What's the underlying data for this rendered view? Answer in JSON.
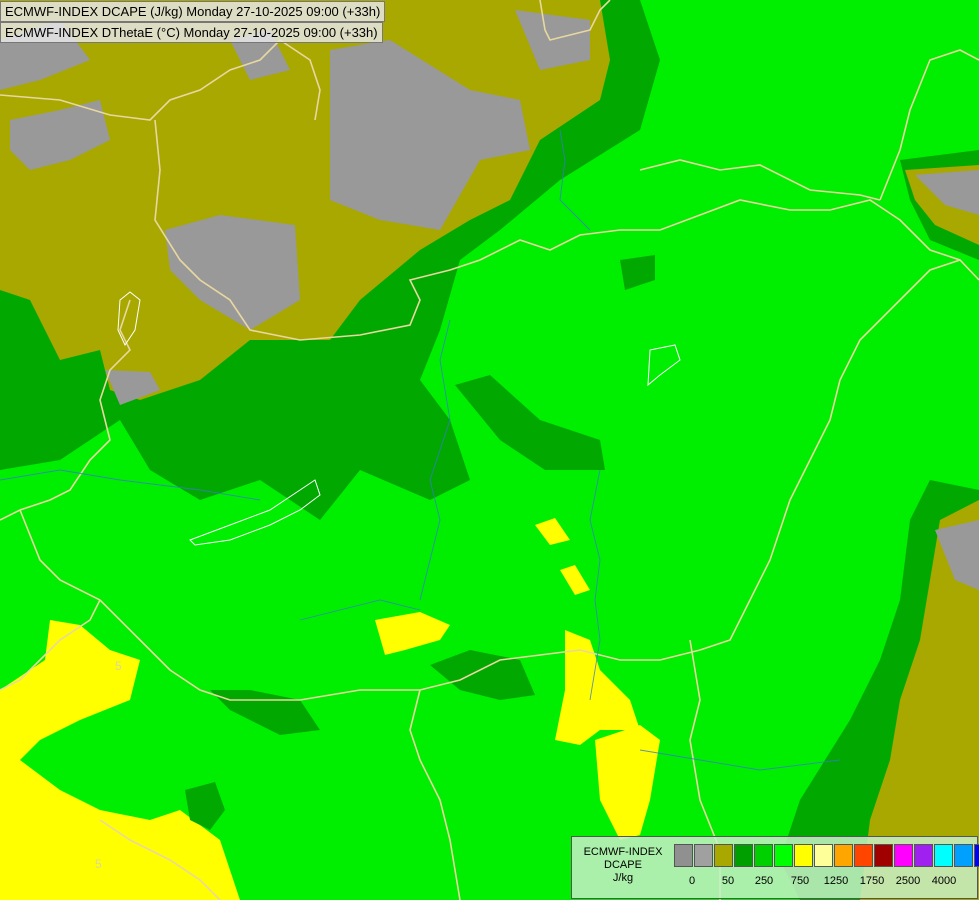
{
  "titles": {
    "line1": "ECMWF-INDEX DCAPE (J/kg) Monday 27-10-2025 09:00 (+33h)",
    "line2": "ECMWF-INDEX DThetaE (°C) Monday 27-10-2025 09:00 (+33h)"
  },
  "contour_labels": [
    "5",
    "5"
  ],
  "legend": {
    "line1": "ECMWF-INDEX",
    "line2": "DCAPE",
    "line3": "J/kg",
    "colors": [
      "#909090",
      "#a0a0a0",
      "#a8a800",
      "#009f00",
      "#00d000",
      "#00ff00",
      "#ffff00",
      "#ffff99",
      "#ffa500",
      "#ff4500",
      "#a00000",
      "#ff00ff",
      "#a020f0",
      "#00ffff",
      "#00a0ff",
      "#0000ff",
      "#00008b"
    ],
    "tick_labels": [
      "0",
      "50",
      "250",
      "750",
      "1250",
      "1750",
      "2500",
      "4000"
    ]
  }
}
